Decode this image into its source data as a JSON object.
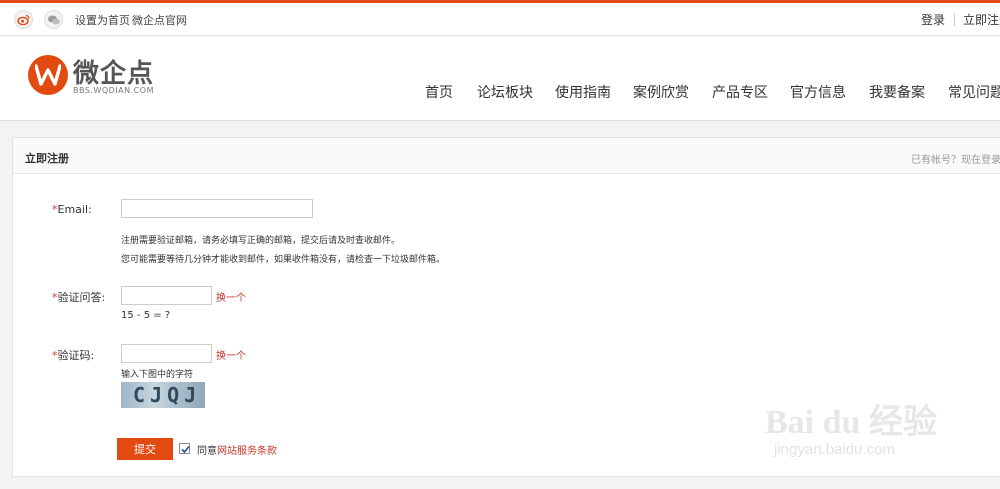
{
  "topbar": {
    "set_home": "设置为首页",
    "official_site": "微企点官网",
    "login": "登录",
    "register": "立即注册"
  },
  "brand": {
    "name": "微企点",
    "domain": "BBS.WQDIAN.COM",
    "color": "#e34a12"
  },
  "nav": [
    "首页",
    "论坛板块",
    "使用指南",
    "案例欣赏",
    "产品专区",
    "官方信息",
    "我要备案",
    "常见问题"
  ],
  "panel": {
    "title": "立即注册",
    "login_prompt": "已有帐号？现在登录"
  },
  "form": {
    "required_mark": "*",
    "email_label": "Email:",
    "email_value": "",
    "email_hint_1": "注册需要验证邮箱，请务必填写正确的邮箱，提交后请及时查收邮件。",
    "email_hint_2": "您可能需要等待几分钟才能收到邮件，如果收件箱没有，请检查一下垃圾邮件箱。",
    "question_label": "验证问答:",
    "question_value": "",
    "question_refresh": "换一个",
    "question_text": "15 - 5 = ?",
    "captcha_label": "验证码:",
    "captcha_value": "",
    "captcha_refresh": "换一个",
    "captcha_hint": "输入下图中的字符",
    "captcha_image_text": "CJQJ",
    "submit": "提交",
    "agree_checked": true,
    "agree_text": "同意",
    "terms_link": "网站服务条款"
  },
  "watermark": {
    "brand": "Bai du 经验",
    "url": "jingyan.baidu.com"
  }
}
